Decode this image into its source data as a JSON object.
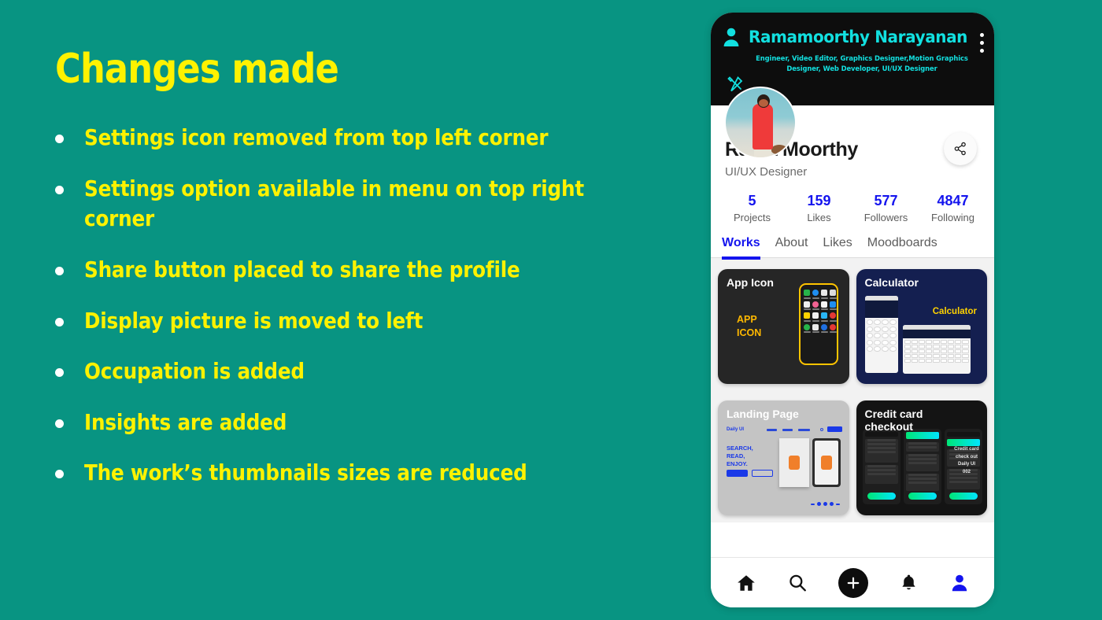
{
  "theme": {
    "background": "#089482",
    "accent_yellow": "#FFF200",
    "cyan": "#12E0E0",
    "blue": "#1414EE"
  },
  "slide": {
    "title": "Changes made",
    "bullets": [
      "Settings icon removed from top left corner",
      "Settings option available in menu on top right corner",
      "Share button placed to share the profile",
      "Display picture is moved to left",
      "Occupation is added",
      "Insights are added",
      "The work’s thumbnails sizes are reduced"
    ]
  },
  "phone": {
    "header": {
      "name": "Ramamoorthy Narayanan",
      "subtitle": "Engineer, Video Editor, Graphics Designer,Motion Graphics Designer, Web Developer, UI/UX Designer",
      "person_icon": "person-icon",
      "menu_icon": "kebab-menu-icon",
      "tools_icon": "tools-icon"
    },
    "profile": {
      "display_name": "Rama Moorthy",
      "occupation": "UI/UX Designer",
      "share_icon": "share-icon"
    },
    "stats": [
      {
        "value": "5",
        "label": "Projects"
      },
      {
        "value": "159",
        "label": "Likes"
      },
      {
        "value": "577",
        "label": "Followers"
      },
      {
        "value": "4847",
        "label": "Following"
      }
    ],
    "tabs": [
      {
        "label": "Works",
        "active": true
      },
      {
        "label": "About",
        "active": false
      },
      {
        "label": "Likes",
        "active": false
      },
      {
        "label": "Moodboards",
        "active": false
      }
    ],
    "works": [
      {
        "title": "App Icon",
        "caption": "APP\nICON",
        "caption_line1": "APP",
        "caption_line2": "ICON"
      },
      {
        "title": "Calculator",
        "caption": "Calculator"
      },
      {
        "title": "Landing Page",
        "heading": "SEARCH,\nREAD,\nENJOY.",
        "brand": "Daily UI"
      },
      {
        "title": "Credit card checkout",
        "note_line1": "Credit card",
        "note_line2": "check out",
        "note_line3": "Daily UI",
        "note_line4": "002"
      }
    ],
    "nav": [
      {
        "icon": "home-icon",
        "label": "Home"
      },
      {
        "icon": "search-icon",
        "label": "Search"
      },
      {
        "icon": "add-icon",
        "label": "Add"
      },
      {
        "icon": "bell-icon",
        "label": "Notifications"
      },
      {
        "icon": "profile-icon",
        "label": "Profile"
      }
    ]
  }
}
